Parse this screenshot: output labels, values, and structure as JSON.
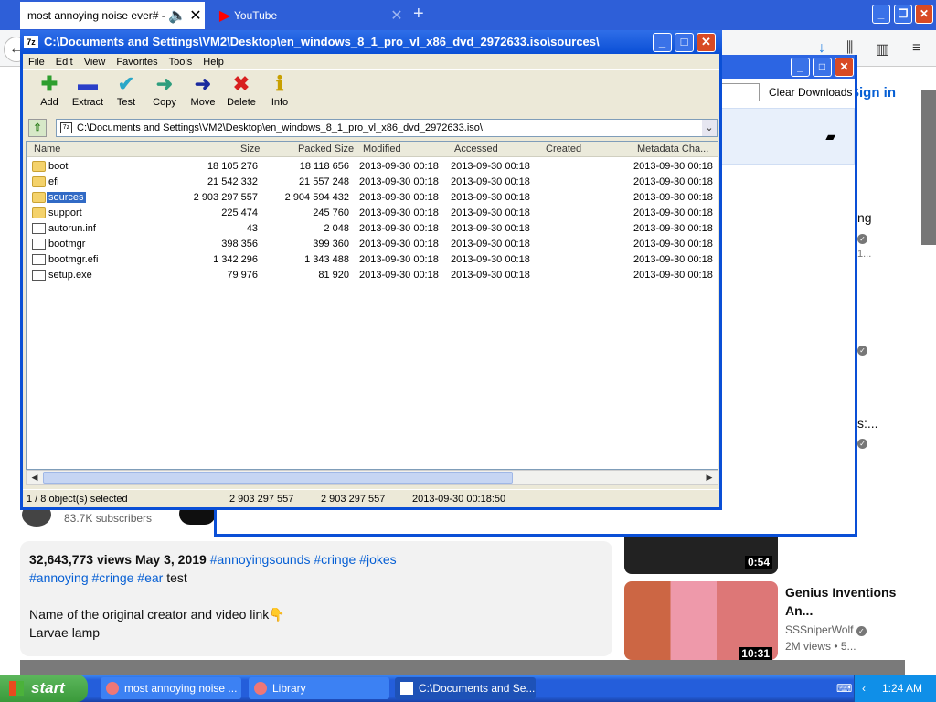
{
  "browser": {
    "tabs": [
      {
        "label": "most annoying noise ever# - Y",
        "close": "✕"
      },
      {
        "label": "YouTube",
        "close": "✕"
      }
    ],
    "newtab": "+",
    "win_buttons": [
      "_",
      "❐",
      "✕"
    ]
  },
  "youtube": {
    "signin": "Sign in",
    "channel_subs": "83.7K subscribers",
    "description": {
      "stats": "32,643,773 views  May 3, 2019",
      "tags_inline": "#annoyingsounds #cringe #jokes",
      "tags_line2": "#annoying #cringe #ear",
      "test": "test",
      "line3": "Name of the original creator and video link👇",
      "line4": "Larvae lamp"
    },
    "side_partial": [
      "ng",
      "1...",
      "s:..."
    ],
    "thumb1_duration": "0:54",
    "video2": {
      "title": "Genius Inventions An...",
      "channel": "SSSniperWolf",
      "meta": "2M views • 5...",
      "duration": "10:31"
    }
  },
  "library": {
    "title": "Library",
    "clear_downloads": "Clear Downloads"
  },
  "sevenzip": {
    "title": "C:\\Documents and Settings\\VM2\\Desktop\\en_windows_8_1_pro_vl_x86_dvd_2972633.iso\\sources\\",
    "menu": [
      "File",
      "Edit",
      "View",
      "Favorites",
      "Tools",
      "Help"
    ],
    "toolbar": [
      {
        "label": "Add",
        "icon": "plus-icon",
        "glyph": "✚",
        "color": "#2e9e2e"
      },
      {
        "label": "Extract",
        "icon": "minus-icon",
        "glyph": "▬",
        "color": "#2a3fc8"
      },
      {
        "label": "Test",
        "icon": "check-icon",
        "glyph": "✔",
        "color": "#2aa7c8"
      },
      {
        "label": "Copy",
        "icon": "copy-arrow-icon",
        "glyph": "➜",
        "color": "#2e9e7e"
      },
      {
        "label": "Move",
        "icon": "move-arrow-icon",
        "glyph": "➜",
        "color": "#1a2a9e"
      },
      {
        "label": "Delete",
        "icon": "delete-x-icon",
        "glyph": "✖",
        "color": "#d82020"
      },
      {
        "label": "Info",
        "icon": "info-icon",
        "glyph": "ℹ",
        "color": "#c8a000"
      }
    ],
    "address": "C:\\Documents and Settings\\VM2\\Desktop\\en_windows_8_1_pro_vl_x86_dvd_2972633.iso\\",
    "columns": [
      "Name",
      "Size",
      "Packed Size",
      "Modified",
      "Accessed",
      "Created",
      "Metadata Cha..."
    ],
    "files": [
      {
        "name": "boot",
        "type": "folder",
        "size": "18 105 276",
        "packed": "18 118 656",
        "modified": "2013-09-30 00:18",
        "accessed": "2013-09-30 00:18",
        "created": "",
        "meta": "2013-09-30 00:18",
        "selected": false
      },
      {
        "name": "efi",
        "type": "folder",
        "size": "21 542 332",
        "packed": "21 557 248",
        "modified": "2013-09-30 00:18",
        "accessed": "2013-09-30 00:18",
        "created": "",
        "meta": "2013-09-30 00:18",
        "selected": false
      },
      {
        "name": "sources",
        "type": "folder",
        "size": "2 903 297 557",
        "packed": "2 904 594 432",
        "modified": "2013-09-30 00:18",
        "accessed": "2013-09-30 00:18",
        "created": "",
        "meta": "2013-09-30 00:18",
        "selected": true
      },
      {
        "name": "support",
        "type": "folder",
        "size": "225 474",
        "packed": "245 760",
        "modified": "2013-09-30 00:18",
        "accessed": "2013-09-30 00:18",
        "created": "",
        "meta": "2013-09-30 00:18",
        "selected": false
      },
      {
        "name": "autorun.inf",
        "type": "file",
        "size": "43",
        "packed": "2 048",
        "modified": "2013-09-30 00:18",
        "accessed": "2013-09-30 00:18",
        "created": "",
        "meta": "2013-09-30 00:18",
        "selected": false
      },
      {
        "name": "bootmgr",
        "type": "file",
        "size": "398 356",
        "packed": "399 360",
        "modified": "2013-09-30 00:18",
        "accessed": "2013-09-30 00:18",
        "created": "",
        "meta": "2013-09-30 00:18",
        "selected": false
      },
      {
        "name": "bootmgr.efi",
        "type": "file",
        "size": "1 342 296",
        "packed": "1 343 488",
        "modified": "2013-09-30 00:18",
        "accessed": "2013-09-30 00:18",
        "created": "",
        "meta": "2013-09-30 00:18",
        "selected": false
      },
      {
        "name": "setup.exe",
        "type": "file",
        "size": "79 976",
        "packed": "81 920",
        "modified": "2013-09-30 00:18",
        "accessed": "2013-09-30 00:18",
        "created": "",
        "meta": "2013-09-30 00:18",
        "selected": false
      }
    ],
    "status": {
      "selection": "1 / 8 object(s) selected",
      "size": "2 903 297 557",
      "packed": "2 903 297 557",
      "modified": "2013-09-30 00:18:50"
    }
  },
  "taskbar": {
    "start": "start",
    "buttons": [
      {
        "label": "most annoying noise ...",
        "active": false
      },
      {
        "label": "Library",
        "active": false
      },
      {
        "label": "C:\\Documents and Se...",
        "active": true
      }
    ],
    "clock": "1:24 AM"
  }
}
